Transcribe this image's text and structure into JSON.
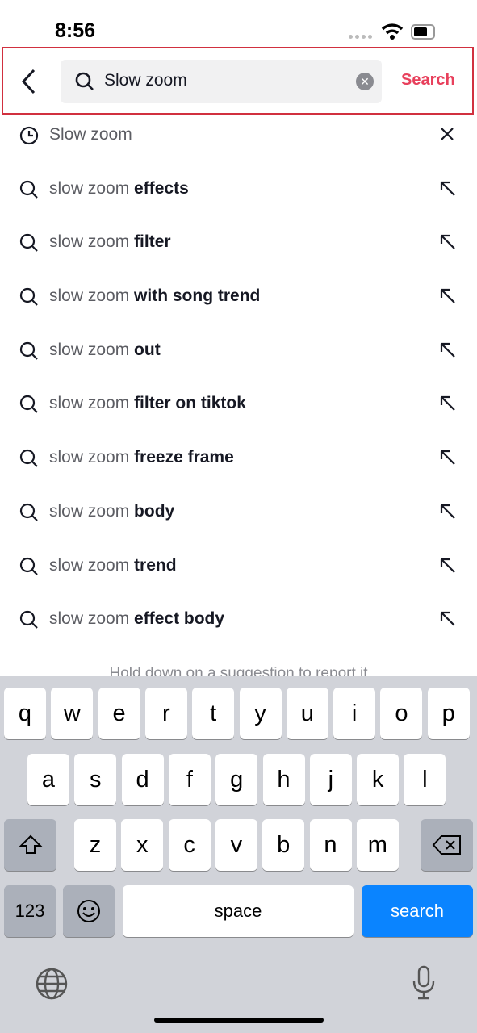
{
  "status": {
    "time": "8:56"
  },
  "header": {
    "query": "Slow zoom",
    "search_label": "Search"
  },
  "history": {
    "text": "Slow zoom"
  },
  "suggestions": [
    {
      "prefix": "slow zoom",
      "bold": "effects"
    },
    {
      "prefix": "slow zoom",
      "bold": "filter"
    },
    {
      "prefix": "slow zoom",
      "bold": "with song trend"
    },
    {
      "prefix": "slow zoom",
      "bold": "out"
    },
    {
      "prefix": "slow zoom",
      "bold": "filter on tiktok"
    },
    {
      "prefix": "slow zoom",
      "bold": "freeze frame"
    },
    {
      "prefix": "slow zoom",
      "bold": "body"
    },
    {
      "prefix": "slow zoom",
      "bold": "trend"
    },
    {
      "prefix": "slow zoom",
      "bold": "effect body"
    }
  ],
  "hint": "Hold down on a suggestion to report it",
  "keyboard": {
    "row1": [
      "q",
      "w",
      "e",
      "r",
      "t",
      "y",
      "u",
      "i",
      "o",
      "p"
    ],
    "row2": [
      "a",
      "s",
      "d",
      "f",
      "g",
      "h",
      "j",
      "k",
      "l"
    ],
    "row3": [
      "z",
      "x",
      "c",
      "v",
      "b",
      "n",
      "m"
    ],
    "numbers": "123",
    "space": "space",
    "search": "search"
  },
  "colors": {
    "accent": "#e8405c",
    "highlight_border": "#d1303f",
    "keyboard_blue": "#0a84ff"
  }
}
